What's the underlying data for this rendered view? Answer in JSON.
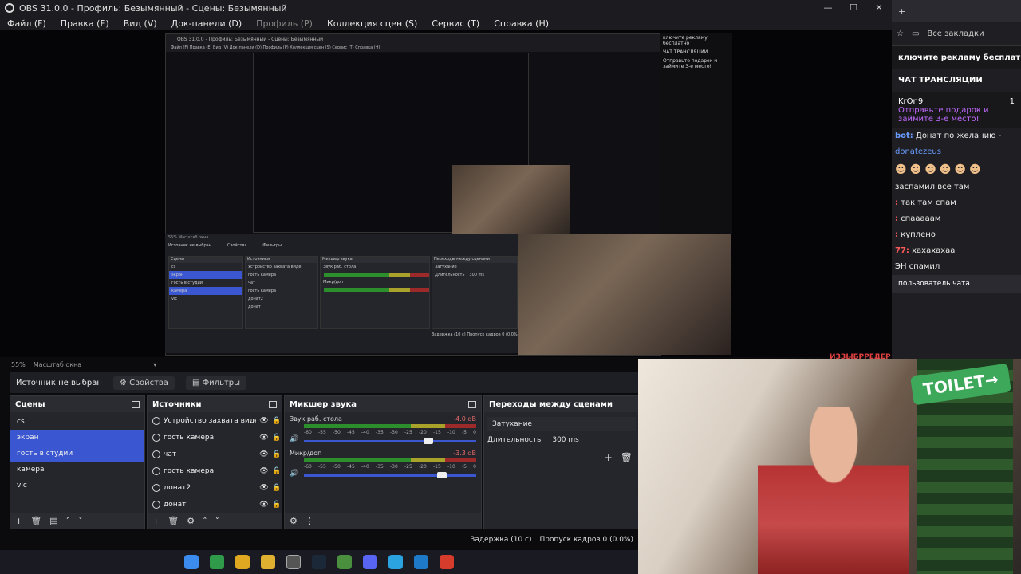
{
  "window": {
    "title": "OBS 31.0.0 - Профиль: Безымянный - Сцены: Безымянный",
    "minimize": "—",
    "maximize": "☐",
    "close": "✕"
  },
  "menu": [
    {
      "label": "Файл (F)",
      "disabled": false
    },
    {
      "label": "Правка (E)",
      "disabled": false
    },
    {
      "label": "Вид (V)",
      "disabled": false
    },
    {
      "label": "Док-панели (D)",
      "disabled": false
    },
    {
      "label": "Профиль (P)",
      "disabled": true
    },
    {
      "label": "Коллекция сцен (S)",
      "disabled": false
    },
    {
      "label": "Сервис (T)",
      "disabled": false
    },
    {
      "label": "Справка (H)",
      "disabled": false
    }
  ],
  "nested_preview": {
    "title": "OBS 31.0.0 - Профиль: Безымянный - Сцены: Безымянный",
    "menu": "Файл (F)   Правка (E)   Вид (V)   Док-панели (D)   Профиль (P)   Коллекция сцен (S)   Сервис (T)   Справка (H)",
    "zoom_label": "55%   Масштаб окна",
    "source_label": "Источник не выбран",
    "props": "Свойства",
    "filters": "Фильтры",
    "scenes_hdr": "Сцены",
    "sources_hdr": "Источники",
    "mixer_hdr": "Микшер звука",
    "trans_hdr": "Переходы между сценами",
    "scenes": [
      "cs",
      "экран",
      "гость в студии",
      "камера",
      "vlc"
    ],
    "sources": [
      "Устройство захвата виде",
      "гость камера",
      "чат",
      "гость камера",
      "донат2",
      "донат"
    ],
    "mixer1": "Звук раб. стола",
    "mixer2": "Микр/доп",
    "trans_sel": "Затухание",
    "duration_label": "Длительность",
    "duration_val": "300 ms",
    "status": "Задержка (10 с)   Пропуск кадров 0 (0.0%)"
  },
  "zoom": {
    "value": "55%",
    "label": "Масштаб окна"
  },
  "source_bar": {
    "no_source": "Источник не выбран",
    "properties": "Свойства",
    "filters": "Фильтры"
  },
  "scenes": {
    "header": "Сцены",
    "items": [
      {
        "label": "cs",
        "selected": false
      },
      {
        "label": "экран",
        "selected": true
      },
      {
        "label": "гость в студии",
        "selected": true
      },
      {
        "label": "камера",
        "selected": false
      },
      {
        "label": "vlc",
        "selected": false
      }
    ]
  },
  "sources": {
    "header": "Источники",
    "items": [
      {
        "label": "Устройство захвата виде"
      },
      {
        "label": "гость камера"
      },
      {
        "label": "чат"
      },
      {
        "label": "гость камера"
      },
      {
        "label": "донат2"
      },
      {
        "label": "донат"
      }
    ]
  },
  "mixer": {
    "header": "Микшер звука",
    "channels": [
      {
        "name": "Звук раб. стола",
        "db": "-4.0 dB",
        "volume": 0.72
      },
      {
        "name": "Микр/доп",
        "db": "-3.3 dB",
        "volume": 0.8
      }
    ],
    "ticks": [
      "-60",
      "-55",
      "-50",
      "-45",
      "-40",
      "-35",
      "-30",
      "-25",
      "-20",
      "-15",
      "-10",
      "-5",
      "0"
    ]
  },
  "transitions": {
    "header": "Переходы между сценами",
    "selected": "Затухание",
    "duration_label": "Длительность",
    "duration_value": "300 ms"
  },
  "status": {
    "delay": "Задержка (10 с)",
    "dropped": "Пропуск кадров 0 (0.0%)"
  },
  "browser": {
    "bookmarks": "Все закладки",
    "promo": "ключите рекламу бесплатно",
    "chat_header": "ЧАТ ТРАНСЛЯЦИИ",
    "gift_user": "KrOn9",
    "gift_count": "1",
    "gift_text": "Отправьте подарок и займите 3-е место!",
    "messages": [
      {
        "user": "bot:",
        "text": "Донат по желанию -",
        "blue": false
      },
      {
        "user": "",
        "text": "donatezeus",
        "blue": true
      },
      {
        "user": "",
        "text": "",
        "blue": false
      },
      {
        "user": "",
        "text": "заспамил все там",
        "blue": false
      },
      {
        "user": ":",
        "text": "так там спам",
        "blue": false
      },
      {
        "user": ":",
        "text": "спааааам",
        "blue": false
      },
      {
        "user": ":",
        "text": "куплено",
        "blue": false
      },
      {
        "user": "77:",
        "text": "хахахахаа",
        "blue": false
      },
      {
        "user": "",
        "text": "ЭН спамил",
        "blue": false
      }
    ],
    "emotes": "☻☻☻☻☻☻",
    "user_action": "пользователь чата"
  },
  "overlay_text": "ИЗЗЫБРРЕДЕР"
}
